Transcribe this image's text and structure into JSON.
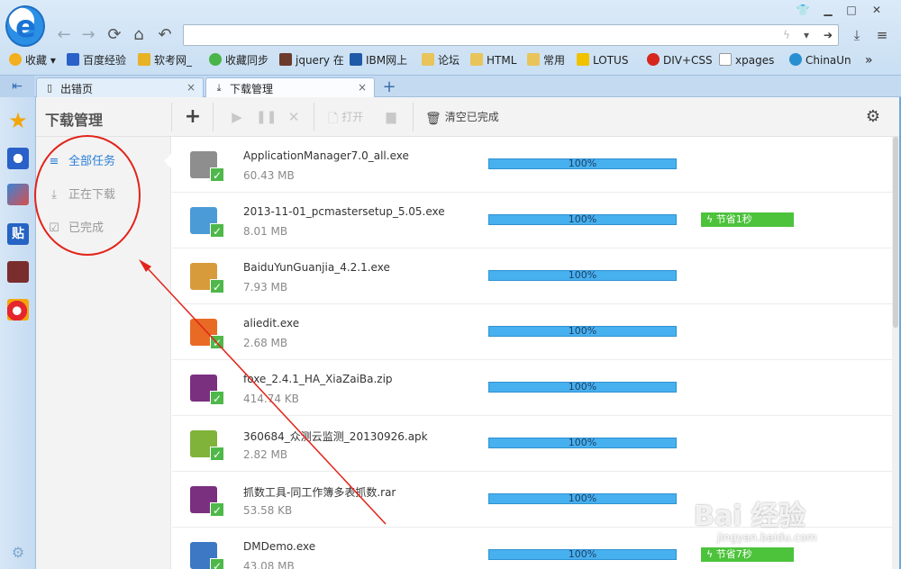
{
  "browser": {
    "address_value": "",
    "nav": {
      "back": "←",
      "forward": "→",
      "refresh": "⟳",
      "home": "⌂",
      "undo": "↶"
    },
    "bookmarks": [
      {
        "label": "收藏",
        "color": "#f2b01e"
      },
      {
        "label": "百度经验",
        "color": "#2a61c9"
      },
      {
        "label": "软考网_",
        "color": "#e7b225"
      },
      {
        "label": "收藏同步",
        "color": "#49b447"
      },
      {
        "label": "jquery 在",
        "color": "#6b3b2b"
      },
      {
        "label": "IBM网上",
        "color": "#1f5aa8"
      },
      {
        "label": "论坛",
        "color": "#e8c45a"
      },
      {
        "label": "HTML",
        "color": "#e8c45a"
      },
      {
        "label": "常用",
        "color": "#e8c45a"
      },
      {
        "label": "LOTUS",
        "color": "#f0c200"
      },
      {
        "label": "DIV+CSS",
        "color": "#d7261e"
      },
      {
        "label": "xpages",
        "color": "#ffffff"
      },
      {
        "label": "ChinaUn",
        "color": "#2a8fd0"
      }
    ],
    "more_label": "»",
    "tabs": [
      {
        "label": "出错页",
        "close": "×"
      },
      {
        "label": "下载管理",
        "close": "×"
      }
    ],
    "new_tab": "+"
  },
  "download_manager": {
    "title": "下载管理",
    "toolbar": {
      "add": "+",
      "start": "▶",
      "pause": "❚❚",
      "delete": "✕",
      "open_label": "打开",
      "clear_label": "清空已完成",
      "settings": "⚙"
    },
    "sidebar": [
      {
        "label": "全部任务",
        "icon": "≡"
      },
      {
        "label": "正在下载",
        "icon": "⤓"
      },
      {
        "label": "已完成",
        "icon": "☑"
      }
    ],
    "files": [
      {
        "name": "ApplicationManager7.0_all.exe",
        "size": "60.43 MB",
        "progress": 100,
        "progress_label": "100%",
        "saved": "",
        "icon_color": "#8e8e8e"
      },
      {
        "name": "2013-11-01_pcmastersetup_5.05.exe",
        "size": "8.01 MB",
        "progress": 100,
        "progress_label": "100%",
        "saved": "节省1秒",
        "icon_color": "#4a9bd6"
      },
      {
        "name": "BaiduYunGuanjia_4.2.1.exe",
        "size": "7.93 MB",
        "progress": 100,
        "progress_label": "100%",
        "saved": "",
        "icon_color": "#d89b3c"
      },
      {
        "name": "aliedit.exe",
        "size": "2.68 MB",
        "progress": 100,
        "progress_label": "100%",
        "saved": "",
        "icon_color": "#e86a25"
      },
      {
        "name": "foxe_2.4.1_HA_XiaZaiBa.zip",
        "size": "414.74 KB",
        "progress": 100,
        "progress_label": "100%",
        "saved": "",
        "icon_color": "#7a2f7f"
      },
      {
        "name": "360684_众测云监测_20130926.apk",
        "size": "2.82 MB",
        "progress": 100,
        "progress_label": "100%",
        "saved": "",
        "icon_color": "#7fb33a"
      },
      {
        "name": "抓数工具-同工作簿多表抓数.rar",
        "size": "53.58 KB",
        "progress": 100,
        "progress_label": "100%",
        "saved": "",
        "icon_color": "#7a2f7f"
      },
      {
        "name": "DMDemo.exe",
        "size": "43.08 MB",
        "progress": 100,
        "progress_label": "100%",
        "saved": "节省7秒",
        "icon_color": "#3c78c4"
      }
    ]
  },
  "watermark": {
    "main": "Bai 经验",
    "sub": "jingyan.baidu.com"
  }
}
